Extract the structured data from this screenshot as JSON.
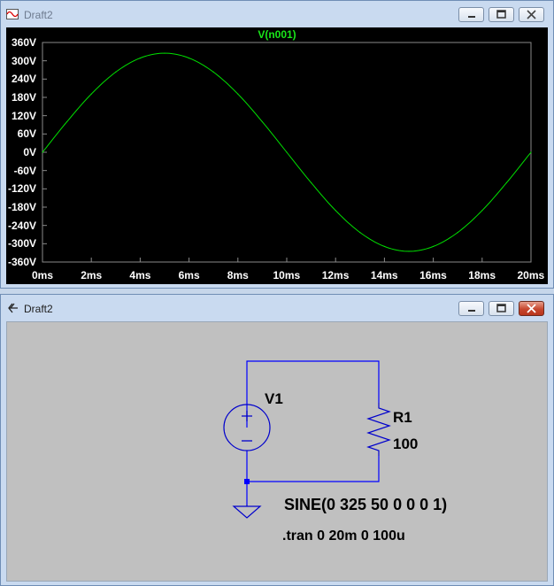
{
  "plot_window": {
    "title": "Draft2",
    "trace_label": "V(n001)",
    "y_ticks": [
      "360V",
      "300V",
      "240V",
      "180V",
      "120V",
      "60V",
      "0V",
      "-60V",
      "-120V",
      "-180V",
      "-240V",
      "-300V",
      "-360V"
    ],
    "x_ticks": [
      "0ms",
      "2ms",
      "4ms",
      "6ms",
      "8ms",
      "10ms",
      "12ms",
      "14ms",
      "16ms",
      "18ms",
      "20ms"
    ],
    "trace_color": "#00e000"
  },
  "chart_data": {
    "type": "line",
    "title": "V(n001)",
    "xlabel": "",
    "ylabel": "",
    "xlim": [
      0,
      20
    ],
    "ylim": [
      -360,
      360
    ],
    "x_unit": "ms",
    "y_unit": "V",
    "grid": false,
    "series": [
      {
        "name": "V(n001)",
        "x": [
          0,
          1,
          2,
          3,
          4,
          5,
          6,
          7,
          8,
          9,
          10,
          11,
          12,
          13,
          14,
          15,
          16,
          17,
          18,
          19,
          20
        ],
        "y": [
          0,
          100,
          191,
          263,
          309,
          325,
          309,
          263,
          191,
          100,
          0,
          -100,
          -191,
          -263,
          -309,
          -325,
          -309,
          -263,
          -191,
          -100,
          0
        ]
      }
    ]
  },
  "schematic_window": {
    "title": "Draft2",
    "source_name": "V1",
    "resistor_name": "R1",
    "resistor_value": "100",
    "source_spec": "SINE(0 325 50 0 0 0 1)",
    "sim_directive": ".tran 0 20m 0 100u",
    "wire_color": "#0000ff"
  }
}
